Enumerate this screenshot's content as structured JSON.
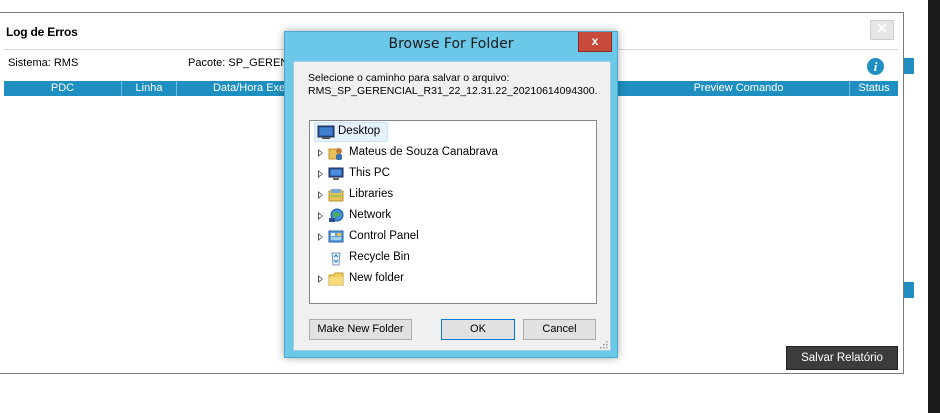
{
  "main": {
    "title": "Log de Erros",
    "close_label": "✕",
    "sistema_label": "Sistema: RMS",
    "pacote_label": "Pacote: SP_GEREN",
    "info_label": "i",
    "grid": {
      "columns": [
        "PDC",
        "Linha",
        "Data/Hora Exe",
        "Preview Comando",
        "Status"
      ]
    },
    "save_report_label": "Salvar Relatório"
  },
  "dialog": {
    "title": "Browse For Folder",
    "close_label": "x",
    "instruction_line1": "Selecione o caminho para salvar o arquivo:",
    "instruction_line2": "RMS_SP_GERENCIAL_R31_22_12.31.22_20210614094300.",
    "tree": [
      {
        "label": "Desktop",
        "icon": "desktop-icon",
        "expandable": false,
        "selected": true
      },
      {
        "label": "Mateus de Souza Canabrava",
        "icon": "user-folder-icon",
        "expandable": true,
        "selected": false
      },
      {
        "label": "This PC",
        "icon": "computer-icon",
        "expandable": true,
        "selected": false
      },
      {
        "label": "Libraries",
        "icon": "libraries-icon",
        "expandable": true,
        "selected": false
      },
      {
        "label": "Network",
        "icon": "network-icon",
        "expandable": true,
        "selected": false
      },
      {
        "label": "Control Panel",
        "icon": "control-panel-icon",
        "expandable": true,
        "selected": false
      },
      {
        "label": "Recycle Bin",
        "icon": "recycle-bin-icon",
        "expandable": false,
        "selected": false
      },
      {
        "label": "New folder",
        "icon": "folder-icon",
        "expandable": true,
        "selected": false
      }
    ],
    "buttons": {
      "make_new_folder": "Make New Folder",
      "ok": "OK",
      "cancel": "Cancel"
    }
  },
  "colors": {
    "accent": "#1e8fc0",
    "dialog_frame": "#6cc8e8",
    "close_red": "#c74a3b",
    "dark_button": "#3c3c3c"
  }
}
